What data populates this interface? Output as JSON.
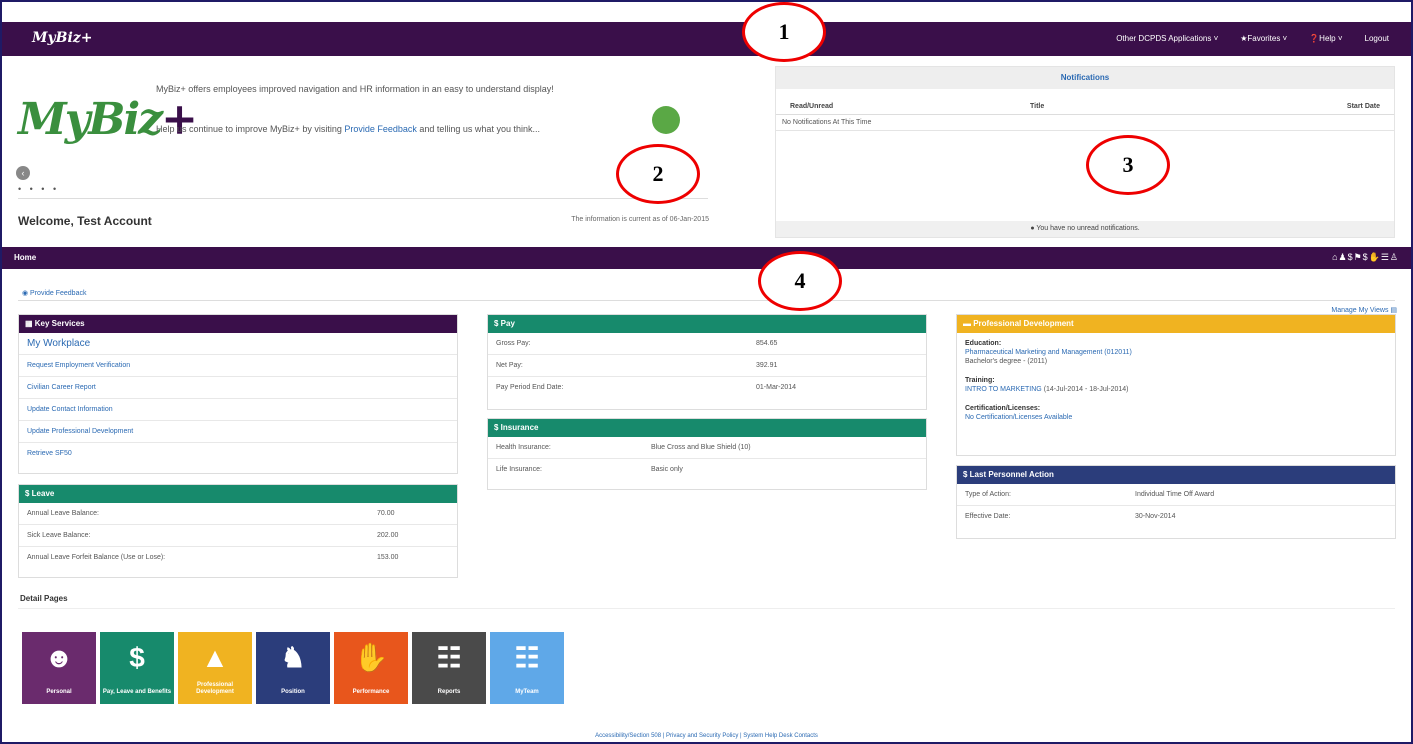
{
  "topbar": {
    "brand": "MyBiz+",
    "menu": [
      "Other DCPDS Applications ˅",
      "★Favorites ˅",
      "❓Help ˅",
      "Logout"
    ]
  },
  "callouts": [
    "1",
    "2",
    "3",
    "4"
  ],
  "hero": {
    "logo_main": "MyBiz",
    "logo_plus": "+",
    "text1": "MyBiz+ offers employees improved navigation and HR information in an easy to understand display!",
    "text2_before": "Help us continue to improve MyBiz+ by visiting ",
    "text2_link": "Provide Feedback",
    "text2_after": " and telling us what you think...",
    "prev_icon": "‹",
    "dots": "• • • •",
    "welcome": "Welcome, Test Account",
    "current_info": "The information is current as of 06-Jan-2015"
  },
  "notifications": {
    "title": "Notifications",
    "columns": [
      "Read/Unread",
      "Title",
      "Start Date"
    ],
    "empty_row": "No Notifications At This Time",
    "footer": "●  You have no unread notifications."
  },
  "navbar": {
    "home": "Home",
    "icons": "⌂♟$⚑$✋☰♙"
  },
  "breadcrumb": {
    "feedback": "◉ Provide Feedback"
  },
  "manage_views": "Manage My Views ▤",
  "key_services": {
    "title": "▦ Key Services",
    "workplace": "My Workplace",
    "links": [
      "Request Employment Verification",
      "Civilian Career Report",
      "Update Contact Information",
      "Update Professional Development",
      "Retrieve SF50"
    ]
  },
  "leave": {
    "title": "$ Leave",
    "rows": [
      {
        "label": "Annual Leave Balance:",
        "value": "70.00"
      },
      {
        "label": "Sick Leave Balance:",
        "value": "202.00"
      },
      {
        "label": "Annual Leave Forfeit Balance (Use or Lose):",
        "value": "153.00"
      }
    ]
  },
  "pay": {
    "title": "$ Pay",
    "rows": [
      {
        "label": "Gross Pay:",
        "value": "854.65"
      },
      {
        "label": "Net Pay:",
        "value": "392.91"
      },
      {
        "label": "Pay Period End Date:",
        "value": "01-Mar-2014"
      }
    ]
  },
  "insurance": {
    "title": "$ Insurance",
    "rows": [
      {
        "label": "Health Insurance:",
        "value": "Blue Cross and Blue Shield (10)"
      },
      {
        "label": "Life Insurance:",
        "value": "Basic only"
      }
    ]
  },
  "prof_dev": {
    "title": "▬  Professional Development",
    "education_label": "Education:",
    "education_link": "Pharmaceutical Marketing and Management (012011)",
    "education_degree": "Bachelor's degree - (2011)",
    "training_label": "Training:",
    "training_link": "INTRO TO MARKETING",
    "training_dates": " (14-Jul-2014 - 18-Jul-2014)",
    "cert_label": "Certification/Licenses:",
    "cert_link": "No Certification/Licenses Available"
  },
  "last_action": {
    "title": "$ Last Personnel Action",
    "rows": [
      {
        "label": "Type of Action:",
        "value": "Individual Time Off Award"
      },
      {
        "label": "Effective Date:",
        "value": "30-Nov-2014"
      }
    ]
  },
  "detail_pages": {
    "title": "Detail Pages",
    "tiles": [
      {
        "label": "Personal",
        "icon": "person-icon",
        "glyph": "☻",
        "color": "#6a2b6d"
      },
      {
        "label": "Pay, Leave and Benefits",
        "icon": "dollar-icon",
        "glyph": "$",
        "color": "#178a6c"
      },
      {
        "label": "Professional Development",
        "icon": "graduation-cap-icon",
        "glyph": "▲",
        "color": "#f0b321"
      },
      {
        "label": "Position",
        "icon": "position-icon",
        "glyph": "♞",
        "color": "#2b3d7b"
      },
      {
        "label": "Performance",
        "icon": "thumbs-up-icon",
        "glyph": "✋",
        "color": "#e8561c"
      },
      {
        "label": "Reports",
        "icon": "document-icon",
        "glyph": "☷",
        "color": "#4a4a4a"
      },
      {
        "label": "MyTeam",
        "icon": "org-chart-icon",
        "glyph": "☷",
        "color": "#5fa8e8"
      }
    ]
  },
  "footer": "Accessibility/Section 508 | Privacy and Security Policy | System Help Desk Contacts"
}
